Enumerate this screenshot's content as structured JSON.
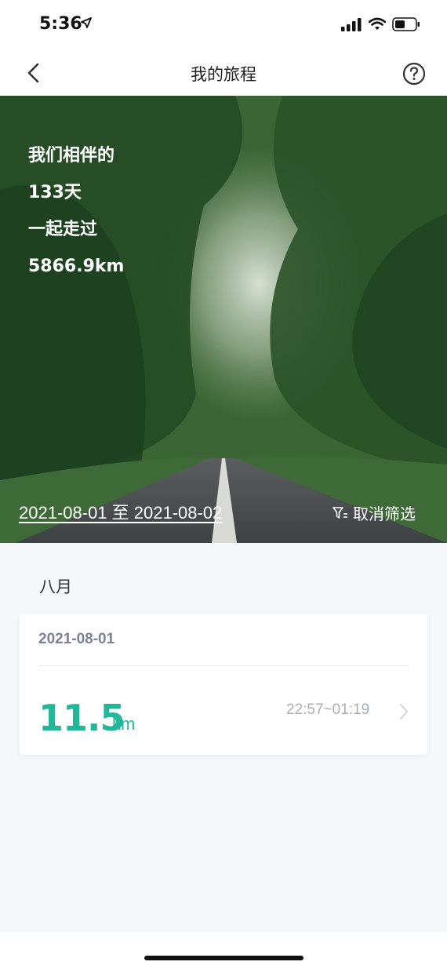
{
  "status_bar": {
    "time": "5:36",
    "icons": [
      "location-arrow-icon",
      "signal-icon",
      "wifi-icon",
      "battery-icon"
    ]
  },
  "nav": {
    "title": "我的旅程",
    "back_icon": "chevron-left-icon",
    "help_icon": "question-circle-icon"
  },
  "hero": {
    "line1": "我们相伴的",
    "days": "133天",
    "line3": "一起走过",
    "distance_total": "5866.9km",
    "date_range": "2021-08-01 至 2021-08-02",
    "cancel_filter_label": "取消筛选",
    "filter_icon": "filter-icon"
  },
  "list": {
    "month": "八月",
    "trips": [
      {
        "date": "2021-08-01",
        "distance": "11.5",
        "unit": "km",
        "time_range": "22:57~01:19"
      }
    ]
  },
  "colors": {
    "accent": "#22b69b",
    "muted": "#7c8294",
    "background": "#f5f7fb"
  }
}
